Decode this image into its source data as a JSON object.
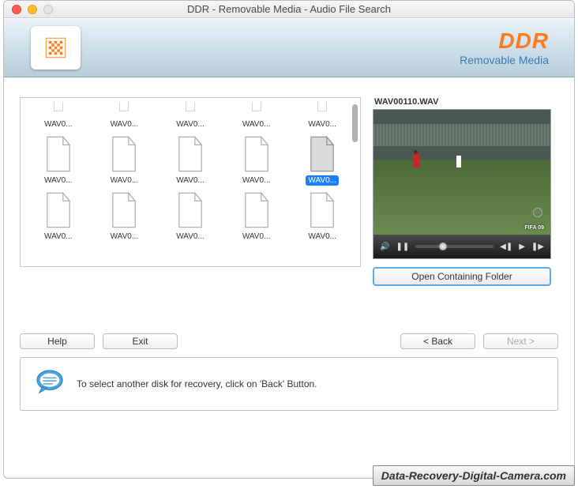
{
  "window": {
    "title": "DDR - Removable Media - Audio File Search"
  },
  "brand": {
    "name": "DDR",
    "subtitle": "Removable Media"
  },
  "files": [
    {
      "label": "WAV0...",
      "selected": false,
      "partial": true
    },
    {
      "label": "WAV0...",
      "selected": false,
      "partial": true
    },
    {
      "label": "WAV0...",
      "selected": false,
      "partial": true
    },
    {
      "label": "WAV0...",
      "selected": false,
      "partial": true
    },
    {
      "label": "WAV0...",
      "selected": false,
      "partial": true
    },
    {
      "label": "WAV0...",
      "selected": false,
      "partial": false
    },
    {
      "label": "WAV0...",
      "selected": false,
      "partial": false
    },
    {
      "label": "WAV0...",
      "selected": false,
      "partial": false
    },
    {
      "label": "WAV0...",
      "selected": false,
      "partial": false
    },
    {
      "label": "WAV0...",
      "selected": true,
      "partial": false
    },
    {
      "label": "WAV0...",
      "selected": false,
      "partial": false
    },
    {
      "label": "WAV0...",
      "selected": false,
      "partial": false
    },
    {
      "label": "WAV0...",
      "selected": false,
      "partial": false
    },
    {
      "label": "WAV0...",
      "selected": false,
      "partial": false
    },
    {
      "label": "WAV0...",
      "selected": false,
      "partial": false
    }
  ],
  "preview": {
    "filename": "WAV00110.WAV",
    "fifa_text": "FIFA 09",
    "open_folder_label": "Open Containing Folder"
  },
  "buttons": {
    "help": "Help",
    "exit": "Exit",
    "back": "< Back",
    "next": "Next >"
  },
  "info": {
    "text": "To select another disk for recovery, click on 'Back' Button."
  },
  "watermark": "Data-Recovery-Digital-Camera.com"
}
